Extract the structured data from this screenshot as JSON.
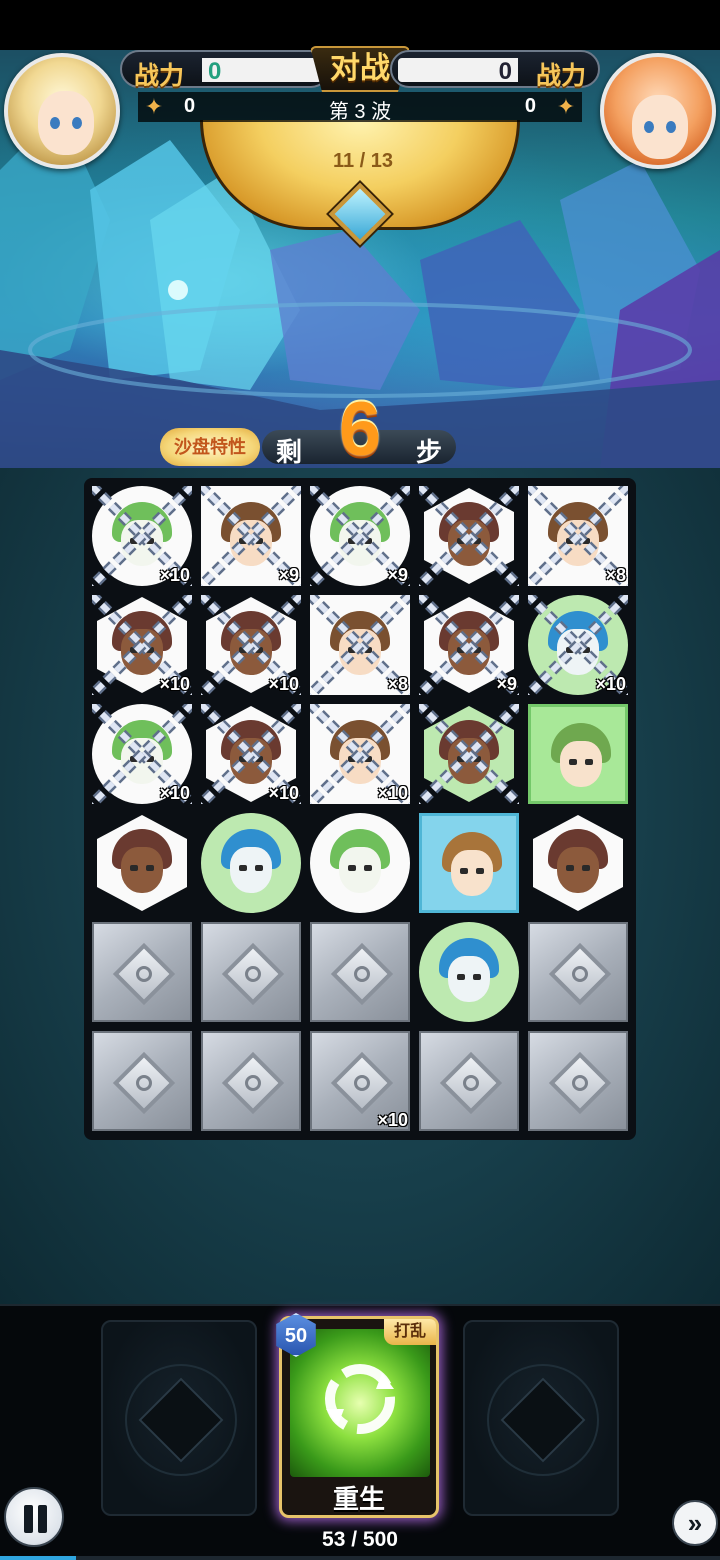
{
  "header": {
    "player_power_label": "战力",
    "player_power": "0",
    "opponent_power_label": "战力",
    "opponent_power": "0",
    "vs_label": "对战",
    "player_stars": "0",
    "opponent_stars": "0",
    "wave_label": "第 3 波",
    "wave_progress": "11 / 13",
    "star_icon": "✦"
  },
  "steps": {
    "trait_button_label": "沙盘特性",
    "prefix": "剩",
    "remaining": "6",
    "suffix": "步"
  },
  "board": {
    "rows": 6,
    "cols": 5,
    "cells": [
      {
        "row": 0,
        "col": 0,
        "kind": "hero",
        "variant": "green",
        "shape": "circle",
        "locked": true,
        "count": "×10"
      },
      {
        "row": 0,
        "col": 1,
        "kind": "hero",
        "variant": "brown",
        "shape": "square",
        "locked": true,
        "count": "×9"
      },
      {
        "row": 0,
        "col": 2,
        "kind": "hero",
        "variant": "green",
        "shape": "circle",
        "locked": true,
        "count": "×9"
      },
      {
        "row": 0,
        "col": 3,
        "kind": "hero",
        "variant": "boar",
        "shape": "hex",
        "locked": true,
        "count": ""
      },
      {
        "row": 0,
        "col": 4,
        "kind": "hero",
        "variant": "brown",
        "shape": "square",
        "locked": true,
        "count": "×8"
      },
      {
        "row": 1,
        "col": 0,
        "kind": "hero",
        "variant": "boar",
        "shape": "hex",
        "locked": true,
        "count": "×10"
      },
      {
        "row": 1,
        "col": 1,
        "kind": "hero",
        "variant": "boar",
        "shape": "hex",
        "locked": true,
        "count": "×10"
      },
      {
        "row": 1,
        "col": 2,
        "kind": "hero",
        "variant": "brown",
        "shape": "square",
        "locked": true,
        "count": "×8"
      },
      {
        "row": 1,
        "col": 3,
        "kind": "hero",
        "variant": "boar",
        "shape": "hex",
        "locked": true,
        "count": "×9"
      },
      {
        "row": 1,
        "col": 4,
        "kind": "hero",
        "variant": "blue",
        "shape": "circle-mint",
        "locked": true,
        "count": "×10"
      },
      {
        "row": 2,
        "col": 0,
        "kind": "hero",
        "variant": "green",
        "shape": "circle",
        "locked": true,
        "count": "×10"
      },
      {
        "row": 2,
        "col": 1,
        "kind": "hero",
        "variant": "boar",
        "shape": "hex",
        "locked": true,
        "count": "×10"
      },
      {
        "row": 2,
        "col": 2,
        "kind": "hero",
        "variant": "brown",
        "shape": "square",
        "locked": true,
        "count": "×10"
      },
      {
        "row": 2,
        "col": 3,
        "kind": "hero",
        "variant": "boar",
        "shape": "hex-mint",
        "locked": true,
        "count": ""
      },
      {
        "row": 2,
        "col": 4,
        "kind": "hero",
        "variant": "cat",
        "shape": "green-square",
        "locked": false,
        "count": ""
      },
      {
        "row": 3,
        "col": 0,
        "kind": "hero",
        "variant": "boar",
        "shape": "hex",
        "locked": false,
        "count": ""
      },
      {
        "row": 3,
        "col": 1,
        "kind": "hero",
        "variant": "blue",
        "shape": "circle-mint",
        "locked": false,
        "count": ""
      },
      {
        "row": 3,
        "col": 2,
        "kind": "hero",
        "variant": "green",
        "shape": "circle",
        "locked": false,
        "count": ""
      },
      {
        "row": 3,
        "col": 3,
        "kind": "hero",
        "variant": "fox",
        "shape": "blue-square",
        "locked": false,
        "count": ""
      },
      {
        "row": 3,
        "col": 4,
        "kind": "hero",
        "variant": "boar",
        "shape": "hex",
        "locked": false,
        "count": ""
      },
      {
        "row": 4,
        "col": 0,
        "kind": "stone",
        "count": ""
      },
      {
        "row": 4,
        "col": 1,
        "kind": "stone",
        "count": ""
      },
      {
        "row": 4,
        "col": 2,
        "kind": "stone",
        "count": ""
      },
      {
        "row": 4,
        "col": 3,
        "kind": "hero",
        "variant": "blue",
        "shape": "circle-mint",
        "locked": false,
        "count": ""
      },
      {
        "row": 4,
        "col": 4,
        "kind": "stone",
        "count": ""
      },
      {
        "row": 5,
        "col": 0,
        "kind": "stone",
        "count": ""
      },
      {
        "row": 5,
        "col": 1,
        "kind": "stone",
        "count": ""
      },
      {
        "row": 5,
        "col": 2,
        "kind": "stone",
        "count": "×10"
      },
      {
        "row": 5,
        "col": 3,
        "kind": "stone",
        "count": ""
      },
      {
        "row": 5,
        "col": 4,
        "kind": "stone",
        "count": ""
      }
    ]
  },
  "skills": {
    "active": {
      "cost": "50",
      "tag": "打乱",
      "name": "重生",
      "icon": "recycle-icon"
    },
    "energy_text": "53 / 500",
    "energy_fraction": 0.106
  },
  "controls": {
    "fast_forward_glyph": "»"
  },
  "colors": {
    "accent_gold": "#f6c65a",
    "steps_orange": "#ff9a1a",
    "skill_glow": "#c878ff"
  }
}
